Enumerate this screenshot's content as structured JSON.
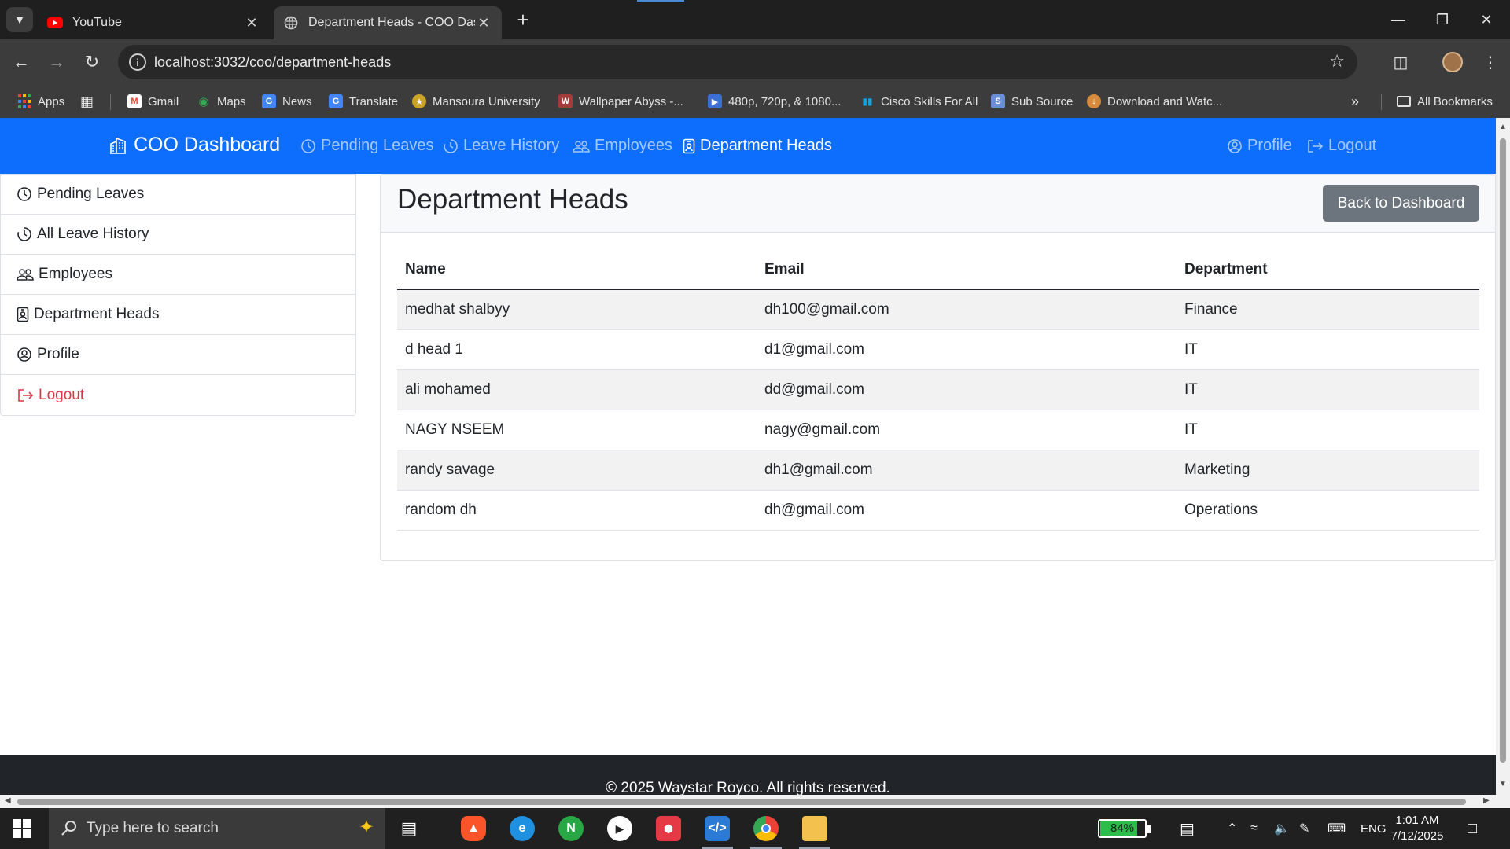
{
  "browser": {
    "tabs": [
      {
        "title": "YouTube",
        "active": false
      },
      {
        "title": "Department Heads - COO Dashboard",
        "active": true
      }
    ],
    "url": "localhost:3032/coo/department-heads",
    "bookmarks": [
      {
        "label": "Apps",
        "icon": "apps-grid-icon",
        "color": "#ea4335"
      },
      {
        "label": "Gmail",
        "icon": "gmail-icon",
        "color": "#ea4335"
      },
      {
        "label": "Maps",
        "icon": "maps-pin-icon",
        "color": "#34a853"
      },
      {
        "label": "News",
        "icon": "news-icon",
        "color": "#4285f4"
      },
      {
        "label": "Translate",
        "icon": "translate-icon",
        "color": "#4285f4"
      },
      {
        "label": "Mansoura University",
        "icon": "university-icon",
        "color": "#c9a227"
      },
      {
        "label": "Wallpaper Abyss -...",
        "icon": "wallpaper-icon",
        "color": "#a33b3b"
      },
      {
        "label": "480p, 720p, & 1080...",
        "icon": "video-icon",
        "color": "#3b6fd6"
      },
      {
        "label": "Cisco Skills For All",
        "icon": "cisco-icon",
        "color": "#1ba0d7"
      },
      {
        "label": "Sub Source",
        "icon": "subsource-icon",
        "color": "#6a8fd6"
      },
      {
        "label": "Download and Watc...",
        "icon": "download-icon",
        "color": "#d68a3b"
      }
    ],
    "all_bookmarks_label": "All Bookmarks"
  },
  "navbar": {
    "brand": "COO Dashboard",
    "links": [
      {
        "label": "Pending Leaves",
        "icon": "clock-icon",
        "active": false
      },
      {
        "label": "Leave History",
        "icon": "clock-history-icon",
        "active": false
      },
      {
        "label": "Employees",
        "icon": "people-icon",
        "active": false
      },
      {
        "label": "Department Heads",
        "icon": "person-badge-icon",
        "active": true
      }
    ],
    "right_links": [
      {
        "label": "Profile",
        "icon": "person-circle-icon"
      },
      {
        "label": "Logout",
        "icon": "logout-icon"
      }
    ]
  },
  "sidebar": {
    "items": [
      {
        "label": "Pending Leaves",
        "icon": "clock-icon"
      },
      {
        "label": "All Leave History",
        "icon": "clock-history-icon"
      },
      {
        "label": "Employees",
        "icon": "people-icon"
      },
      {
        "label": "Department Heads",
        "icon": "person-badge-icon"
      },
      {
        "label": "Profile",
        "icon": "person-circle-icon"
      },
      {
        "label": "Logout",
        "icon": "logout-icon",
        "color": "#dc3545"
      }
    ]
  },
  "main": {
    "title": "Department Heads",
    "back_button": "Back to Dashboard",
    "table": {
      "columns": [
        "Name",
        "Email",
        "Department"
      ],
      "rows": [
        [
          "medhat shalbyy",
          "dh100@gmail.com",
          "Finance"
        ],
        [
          "d head 1",
          "d1@gmail.com",
          "IT"
        ],
        [
          "ali mohamed",
          "dd@gmail.com",
          "IT"
        ],
        [
          "NAGY NSEEM",
          "nagy@gmail.com",
          "IT"
        ],
        [
          "randy savage",
          "dh1@gmail.com",
          "Marketing"
        ],
        [
          "random dh",
          "dh@gmail.com",
          "Operations"
        ]
      ]
    }
  },
  "footer": {
    "text": "© 2025 Waystar Royco. All rights reserved."
  },
  "taskbar": {
    "search_placeholder": "Type here to search",
    "battery_label": "84%",
    "battery_level": 0.84,
    "language": "ENG",
    "time": "1:01 AM",
    "date": "7/12/2025"
  },
  "colors": {
    "primary": "#0d6efd",
    "secondary": "#6c757d",
    "danger": "#dc3545",
    "footer": "#212529"
  }
}
